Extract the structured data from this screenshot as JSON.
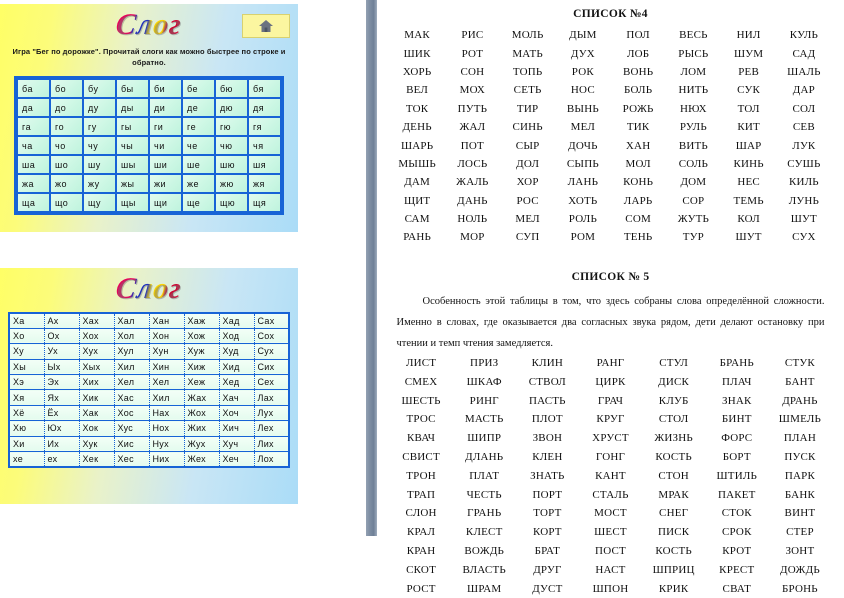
{
  "left_pane": {
    "slide1": {
      "logo": "Слог",
      "home_button_icon": "home-icon",
      "instruction": "Игра \"Бег по дорожке\". Прочитай слоги как можно быстрее по строке и обратно.",
      "syllable_rows": [
        [
          "ба",
          "бо",
          "бу",
          "бы",
          "би",
          "бе",
          "бю",
          "бя"
        ],
        [
          "да",
          "до",
          "ду",
          "ды",
          "ди",
          "де",
          "дю",
          "дя"
        ],
        [
          "га",
          "го",
          "гу",
          "гы",
          "ги",
          "ге",
          "гю",
          "гя"
        ],
        [
          "ча",
          "чо",
          "чу",
          "чы",
          "чи",
          "че",
          "чю",
          "чя"
        ],
        [
          "ша",
          "шо",
          "шу",
          "шы",
          "ши",
          "ше",
          "шю",
          "шя"
        ],
        [
          "жа",
          "жо",
          "жу",
          "жы",
          "жи",
          "же",
          "жю",
          "жя"
        ],
        [
          "ща",
          "що",
          "щу",
          "щы",
          "щи",
          "ще",
          "щю",
          "щя"
        ]
      ]
    },
    "slide2": {
      "logo": "Слог",
      "word_rows": [
        [
          "Ха",
          "Ах",
          "Хах",
          "Хал",
          "Хан",
          "Хаж",
          "Хад",
          "Сах"
        ],
        [
          "Хо",
          "Ох",
          "Хох",
          "Хол",
          "Хон",
          "Хож",
          "Ход",
          "Сох"
        ],
        [
          "Ху",
          "Ух",
          "Хух",
          "Хул",
          "Хун",
          "Хуж",
          "Худ",
          "Сух"
        ],
        [
          "Хы",
          "Ых",
          "Хых",
          "Хил",
          "Хин",
          "Хиж",
          "Хид",
          "Сих"
        ],
        [
          "Хэ",
          "Эх",
          "Хих",
          "Хел",
          "Хел",
          "Хеж",
          "Хед",
          "Сех"
        ],
        [
          "Хя",
          "Ях",
          "Хик",
          "Хас",
          "Хил",
          "Жах",
          "Хач",
          "Лах"
        ],
        [
          "Хё",
          "Ёх",
          "Хак",
          "Хос",
          "Нах",
          "Жох",
          "Хоч",
          "Лух"
        ],
        [
          "Хю",
          "Юх",
          "Хок",
          "Хус",
          "Нох",
          "Жих",
          "Хич",
          "Лех"
        ],
        [
          "Хи",
          "Их",
          "Хук",
          "Хис",
          "Нух",
          "Жух",
          "Хуч",
          "Лих"
        ],
        [
          "хе",
          "ех",
          "Хек",
          "Хес",
          "Них",
          "Жех",
          "Хеч",
          "Лох"
        ]
      ]
    }
  },
  "right_pane": {
    "list4": {
      "title": "СПИСОК №4",
      "rows": [
        [
          "МАК",
          "РИС",
          "МОЛЬ",
          "ДЫМ",
          "ПОЛ",
          "ВЕСЬ",
          "НИЛ",
          "КУЛЬ"
        ],
        [
          "ШИК",
          "РОТ",
          "МАТЬ",
          "ДУХ",
          "ЛОБ",
          "РЫСЬ",
          "ШУМ",
          "САД"
        ],
        [
          "ХОРЬ",
          "СОН",
          "ТОПЬ",
          "РОК",
          "ВОНЬ",
          "ЛОМ",
          "РЕВ",
          "ШАЛЬ"
        ],
        [
          "ВЕЛ",
          "МОХ",
          "СЕТЬ",
          "НОС",
          "БОЛЬ",
          "НИТЬ",
          "СУК",
          "ДАР"
        ],
        [
          "ТОК",
          "ПУТЬ",
          "ТИР",
          "ВЫНЬ",
          "РОЖЬ",
          "НЮХ",
          "ТОЛ",
          "СОЛ"
        ],
        [
          "ДЕНЬ",
          "ЖАЛ",
          "СИНЬ",
          "МЕЛ",
          "ТИК",
          "РУЛЬ",
          "КИТ",
          "СЕВ"
        ],
        [
          "ШАРЬ",
          "ПОТ",
          "СЫР",
          "ДОЧЬ",
          "ХАН",
          "ВИТЬ",
          "ШАР",
          "ЛУК"
        ],
        [
          "МЫШЬ",
          "ЛОСЬ",
          "ДОЛ",
          "СЫПЬ",
          "МОЛ",
          "СОЛЬ",
          "КИНЬ",
          "СУШЬ"
        ],
        [
          "ДАМ",
          "ЖАЛЬ",
          "ХОР",
          "ЛАНЬ",
          "КОНЬ",
          "ДОМ",
          "НЕС",
          "КИЛЬ"
        ],
        [
          "ЩИТ",
          "ДАНЬ",
          "РОС",
          "ХОТЬ",
          "ЛАРЬ",
          "СОР",
          "ТЕМЬ",
          "ЛУНЬ"
        ],
        [
          "САМ",
          "НОЛЬ",
          "МЕЛ",
          "РОЛЬ",
          "СОМ",
          "ЖУТЬ",
          "КОЛ",
          "ШУТ"
        ],
        [
          "РАНЬ",
          "МОР",
          "СУП",
          "РОМ",
          "ТЕНЬ",
          "ТУР",
          "ШУТ",
          "СУХ"
        ]
      ]
    },
    "list5": {
      "title": "СПИСОК № 5",
      "description": "Особенность этой таблицы в том, что здесь собраны слова определённой сложности. Именно в словах, где оказывается два  согласных звука рядом, дети делают остановку при чтении и темп чтения замедляется.",
      "rows": [
        [
          "ЛИСТ",
          "ПРИЗ",
          "КЛИН",
          "РАНГ",
          "СТУЛ",
          "БРАНЬ",
          "СТУК"
        ],
        [
          "СМЕХ",
          "ШКАФ",
          "СТВОЛ",
          "ЦИРК",
          "ДИСК",
          "ПЛАЧ",
          "БАНТ"
        ],
        [
          "ШЕСТЬ",
          "РИНГ",
          "ПАСТЬ",
          "ГРАЧ",
          "КЛУБ",
          "ЗНАК",
          "ДРАНЬ"
        ],
        [
          "ТРОС",
          "МАСТЬ",
          "ПЛОТ",
          "КРУГ",
          "СТОЛ",
          "БИНТ",
          "ШМЕЛЬ"
        ],
        [
          "КВАЧ",
          "ШИПР",
          "ЗВОН",
          "ХРУСТ",
          "ЖИЗНЬ",
          "ФОРС",
          "ПЛАН"
        ],
        [
          "СВИСТ",
          "ДЛАНЬ",
          "КЛЕН",
          "ГОНГ",
          "КОСТЬ",
          "БОРТ",
          "ПУСК"
        ],
        [
          "ТРОН",
          "ПЛАТ",
          "ЗНАТЬ",
          "КАНТ",
          "СТОН",
          "ШТИЛЬ",
          "ПАРК"
        ],
        [
          "ТРАП",
          "ЧЕСТЬ",
          "ПОРТ",
          "СТАЛЬ",
          "МРАК",
          "ПАКЕТ",
          "БАНК"
        ],
        [
          "СЛОН",
          "ГРАНЬ",
          "ТОРТ",
          "МОСТ",
          "СНЕГ",
          "СТОК",
          "ВИНТ"
        ],
        [
          "КРАЛ",
          "КЛЕСТ",
          "КОРТ",
          "ШЕСТ",
          "ПИСК",
          "СРОК",
          "СТЕР"
        ],
        [
          "КРАН",
          "ВОЖДЬ",
          "БРАТ",
          "ПОСТ",
          "КОСТЬ",
          "КРОТ",
          "ЗОНТ"
        ],
        [
          "СКОТ",
          "ВЛАСТЬ",
          "ДРУГ",
          "НАСТ",
          "ШПРИЦ",
          "КРЕСТ",
          "ДОЖДЬ"
        ],
        [
          "РОСТ",
          "ШРАМ",
          "ДУСТ",
          "ШПОН",
          "КРИК",
          "СВАТ",
          "БРОНЬ"
        ]
      ]
    }
  },
  "colors": {
    "grid_border_blue": "#1763d6",
    "cell_green": "#e4fbee",
    "panel_yellow": "#ffff66",
    "panel_blue": "#aadcf7",
    "divider_gray": "#7d8da2"
  }
}
